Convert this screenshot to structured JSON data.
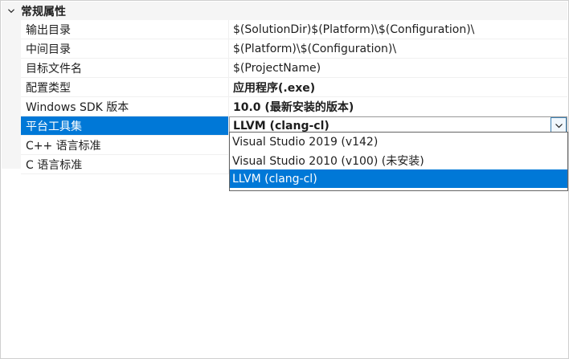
{
  "category": {
    "label": "常规属性"
  },
  "properties": [
    {
      "name": "输出目录",
      "value": "$(SolutionDir)$(Platform)\\$(Configuration)\\"
    },
    {
      "name": "中间目录",
      "value": "$(Platform)\\$(Configuration)\\"
    },
    {
      "name": "目标文件名",
      "value": "$(ProjectName)"
    },
    {
      "name": "配置类型",
      "value": "应用程序(.exe)"
    },
    {
      "name": "Windows SDK 版本",
      "value": "10.0 (最新安装的版本)"
    },
    {
      "name": "平台工具集",
      "value": "LLVM (clang-cl)"
    },
    {
      "name": "C++ 语言标准",
      "value": ""
    },
    {
      "name": "C 语言标准",
      "value": ""
    }
  ],
  "dropdown": {
    "options": [
      "Visual Studio 2019 (v142)",
      "Visual Studio 2010 (v100) (未安装)",
      "LLVM (clang-cl)"
    ],
    "selected_index": 2
  },
  "icons": {
    "collapse": "collapse-chevron-icon",
    "combo_arrow": "chevron-down-icon"
  },
  "colors": {
    "selection": "#0078d7",
    "category_background": "#f5f5f5"
  }
}
